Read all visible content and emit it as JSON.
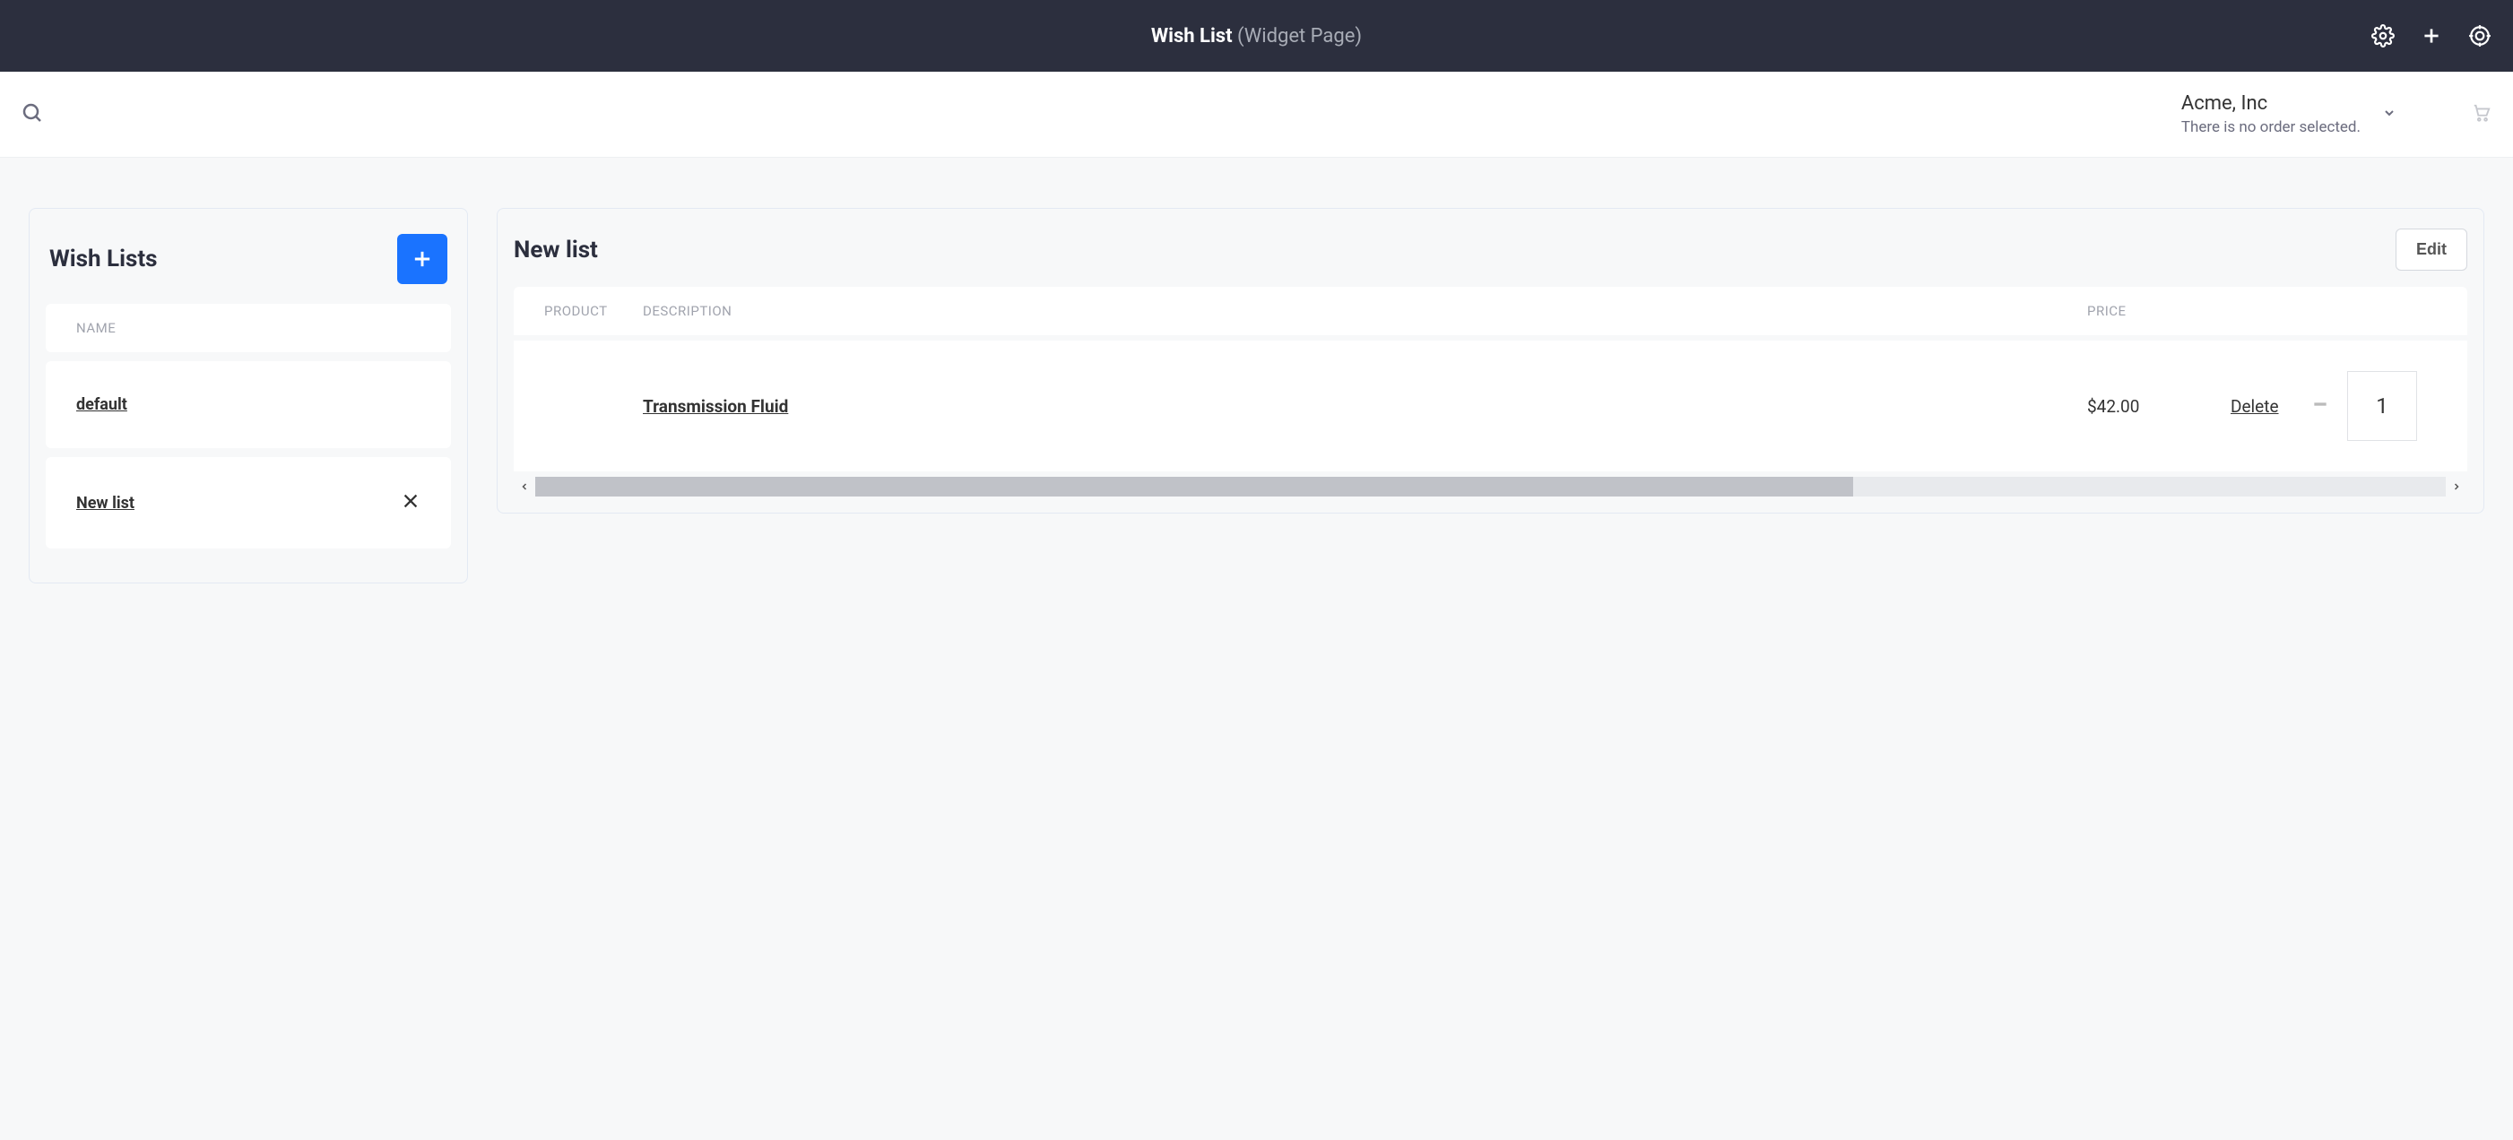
{
  "topbar": {
    "title_bold": "Wish List",
    "title_sub": "(Widget Page)"
  },
  "subbar": {
    "account_name": "Acme, Inc",
    "account_sub": "There is no order selected."
  },
  "sidebar": {
    "title": "Wish Lists",
    "header_name": "NAME",
    "rows": [
      {
        "label": "default",
        "closable": false
      },
      {
        "label": "New list",
        "closable": true
      }
    ]
  },
  "detail": {
    "title": "New list",
    "edit_label": "Edit",
    "columns": {
      "product": "PRODUCT",
      "description": "DESCRIPTION",
      "price": "PRICE"
    },
    "row": {
      "name": "Transmission Fluid",
      "price": "$42.00",
      "delete": "Delete",
      "qty": "1"
    }
  }
}
